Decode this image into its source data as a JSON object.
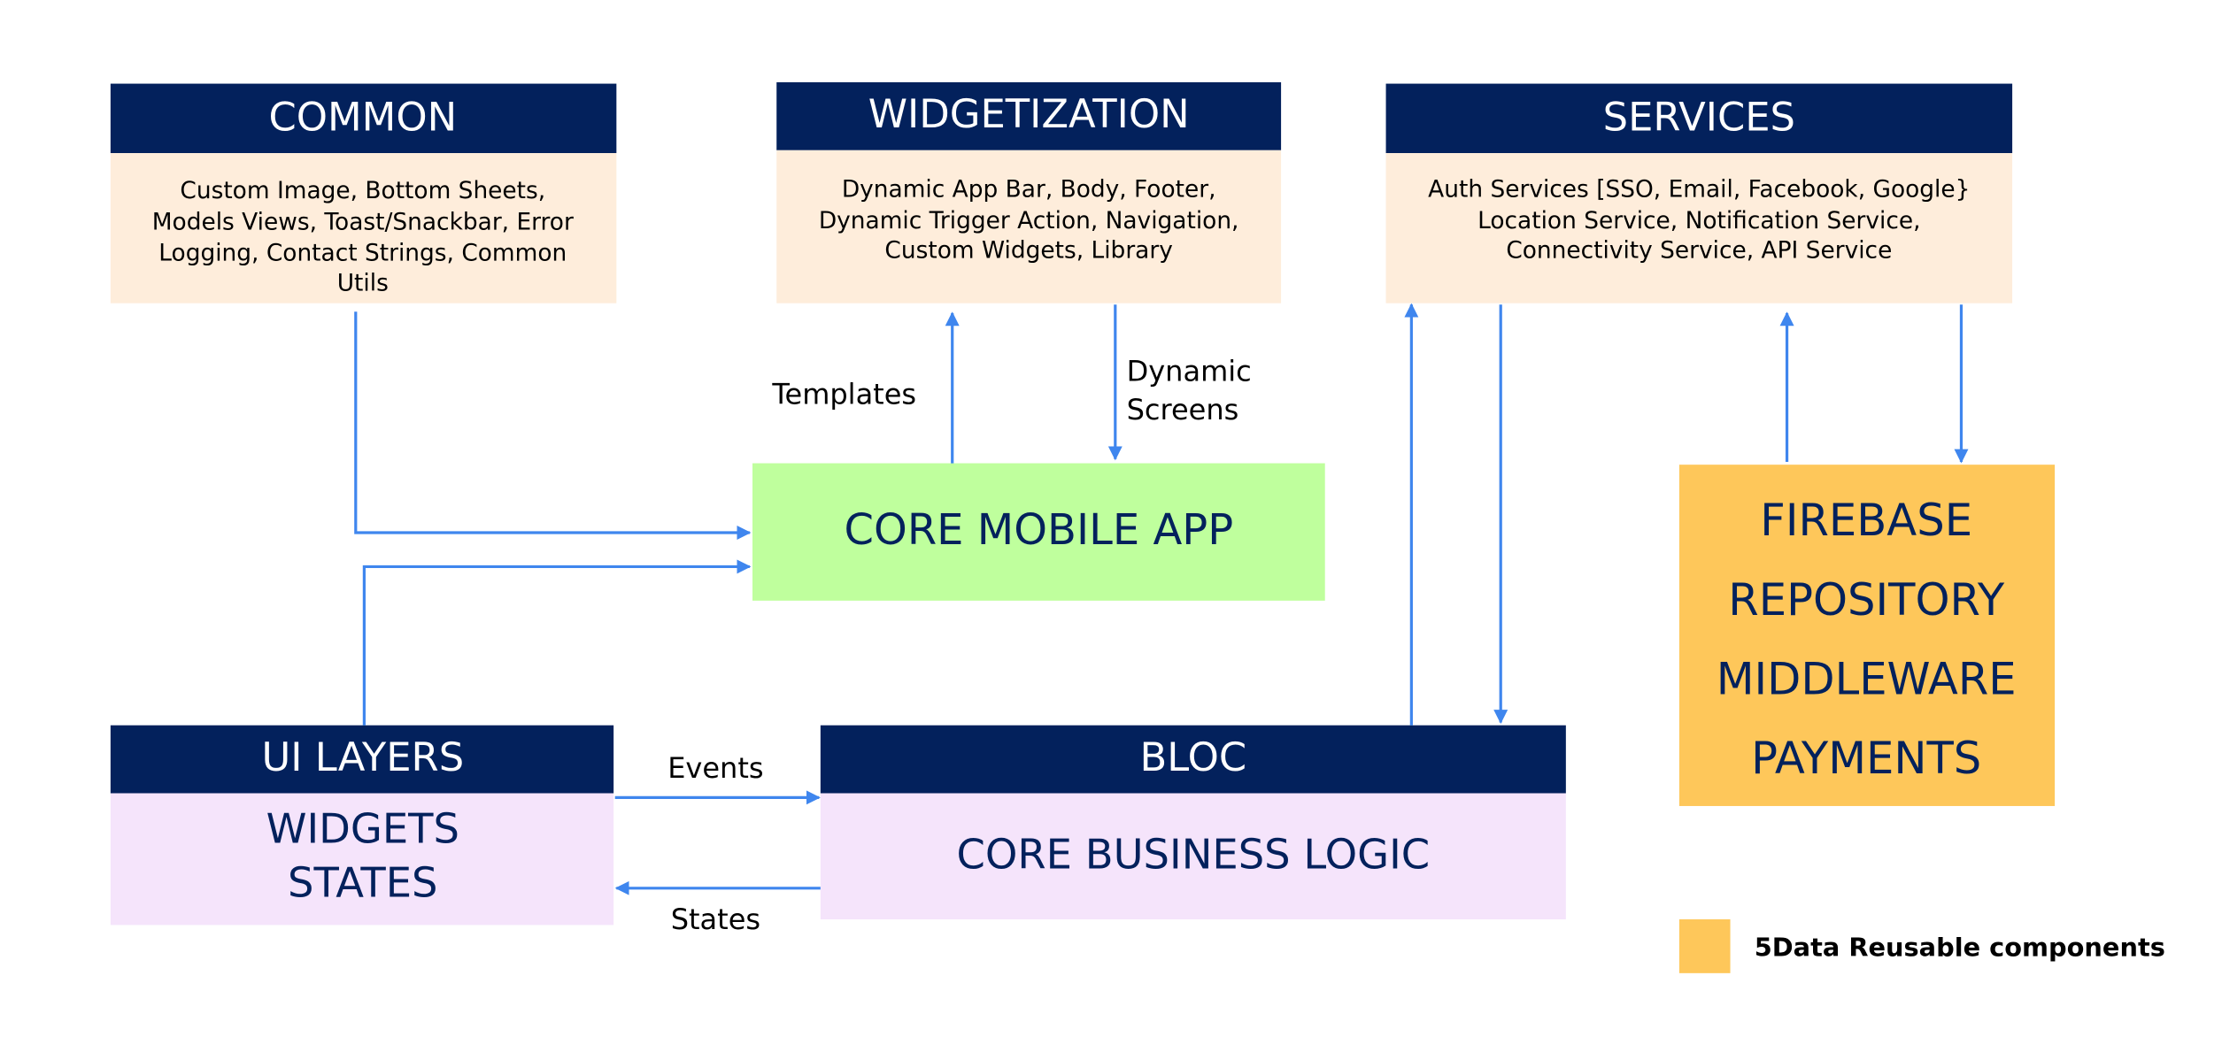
{
  "common": {
    "title": "COMMON",
    "lines": [
      "Custom Image, Bottom Sheets,",
      "Models Views, Toast/Snackbar, Error",
      "Logging, Contact Strings, Common",
      "Utils"
    ]
  },
  "widgetization": {
    "title": "WIDGETIZATION",
    "lines": [
      "Dynamic App Bar, Body, Footer,",
      "Dynamic Trigger Action, Navigation,",
      "Custom Widgets, Library"
    ]
  },
  "services": {
    "title": "SERVICES",
    "lines": [
      "Auth Services [SSO, Email, Facebook, Google}",
      "Location Service, Notification Service,",
      "Connectivity Service, API Service"
    ]
  },
  "core_app": {
    "title": "CORE MOBILE APP"
  },
  "reusable": {
    "lines": [
      "FIREBASE",
      "REPOSITORY",
      "MIDDLEWARE",
      "PAYMENTS"
    ]
  },
  "ui_layers": {
    "title": "UI LAYERS",
    "lines": [
      "WIDGETS",
      "STATES"
    ]
  },
  "bloc": {
    "title": "BLOC",
    "body": "CORE BUSINESS LOGIC"
  },
  "edges": {
    "templates": "Templates",
    "dynamic_screens": [
      "Dynamic",
      "Screens"
    ],
    "events": "Events",
    "states": "States"
  },
  "legend": {
    "label": "5Data Reusable components",
    "color": "#fec75a"
  },
  "colors": {
    "navy": "#03215c",
    "peach": "#feeddb",
    "green": "#bfff9d",
    "lavender": "#f5e4fb",
    "orange": "#fec75a",
    "arrow": "#3f86ee"
  }
}
